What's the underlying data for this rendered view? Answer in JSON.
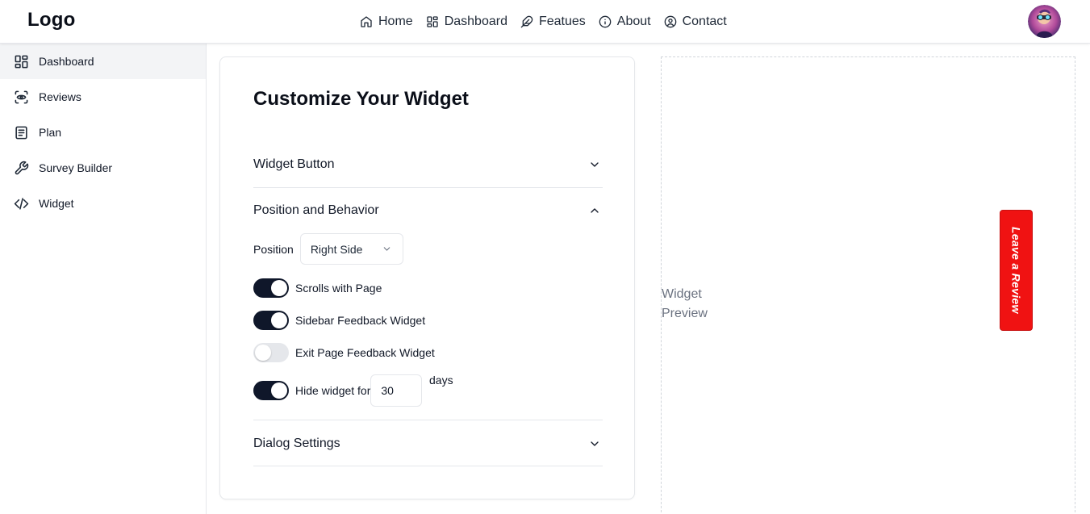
{
  "header": {
    "logo": "Logo",
    "nav": [
      {
        "label": "Home",
        "icon": "home-icon"
      },
      {
        "label": "Dashboard",
        "icon": "dashboard-icon"
      },
      {
        "label": "Featues",
        "icon": "feather-icon"
      },
      {
        "label": "About",
        "icon": "info-icon"
      },
      {
        "label": "Contact",
        "icon": "user-circle-icon"
      }
    ],
    "avatar": "user-avatar"
  },
  "sidebar": {
    "items": [
      {
        "label": "Dashboard",
        "icon": "dashboard-icon",
        "active": true
      },
      {
        "label": "Reviews",
        "icon": "eye-scan-icon",
        "active": false
      },
      {
        "label": "Plan",
        "icon": "file-text-icon",
        "active": false
      },
      {
        "label": "Survey Builder",
        "icon": "wrench-icon",
        "active": false
      },
      {
        "label": "Widget",
        "icon": "code-icon",
        "active": false
      }
    ]
  },
  "main": {
    "title": "Customize Your Widget",
    "sections": [
      {
        "label": "Widget Button",
        "expanded": false
      },
      {
        "label": "Position and Behavior",
        "expanded": true
      },
      {
        "label": "Dialog Settings",
        "expanded": false
      }
    ],
    "position": {
      "label": "Position",
      "value": "Right Side"
    },
    "toggles": [
      {
        "label": "Scrolls with Page",
        "on": true
      },
      {
        "label": "Sidebar Feedback Widget",
        "on": true
      },
      {
        "label": "Exit Page Feedback Widget",
        "on": false
      },
      {
        "label": "Hide widget for",
        "on": true
      }
    ],
    "hide_days": {
      "value": "30",
      "unit": "days"
    }
  },
  "preview": {
    "label": "Widget Preview",
    "review_button": "Leave a Review",
    "colors": {
      "review_button": "#f01212",
      "toggle_on": "#0f172a",
      "toggle_off": "#e5e7eb"
    }
  }
}
